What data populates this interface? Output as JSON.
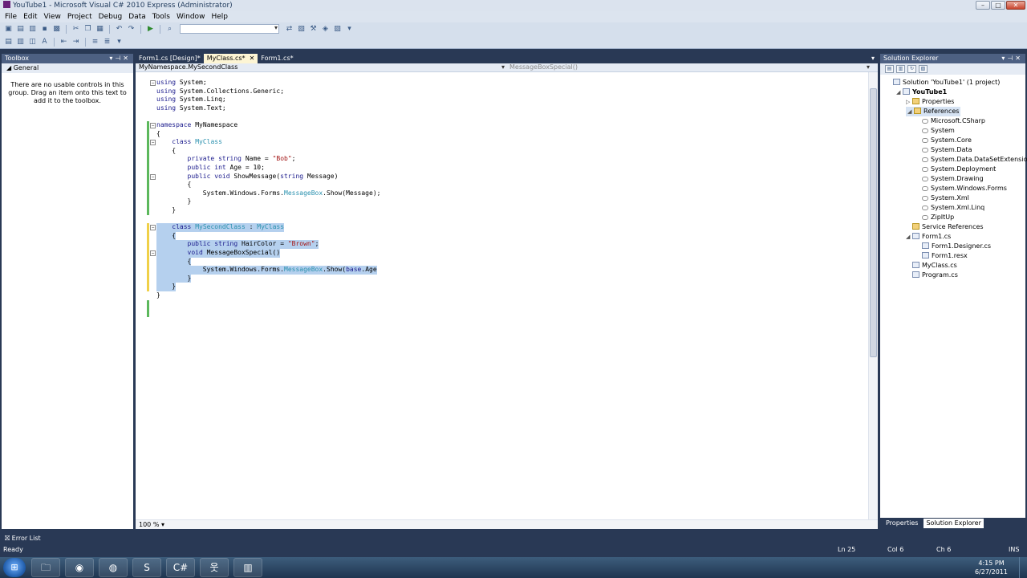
{
  "window": {
    "title": "YouTube1 - Microsoft Visual C# 2010 Express (Administrator)",
    "min": "–",
    "max": "□",
    "close": "✕"
  },
  "menu": [
    "File",
    "Edit",
    "View",
    "Project",
    "Debug",
    "Data",
    "Tools",
    "Window",
    "Help"
  ],
  "toolbox": {
    "title": "Toolbox",
    "group": "General",
    "message": "There are no usable controls in this group. Drag an item onto this text to add it to the toolbox."
  },
  "editor": {
    "tabs": [
      {
        "label": "Form1.cs [Design]*",
        "active": false
      },
      {
        "label": "MyClass.cs*",
        "active": true
      },
      {
        "label": "Form1.cs*",
        "active": false
      }
    ],
    "nav_left": "MyNamespace.MySecondClass",
    "nav_right": "MessageBoxSpecial()",
    "zoom": "100 %",
    "lines": [
      "using System;",
      "using System.Collections.Generic;",
      "using System.Linq;",
      "using System.Text;",
      "",
      "namespace MyNamespace",
      "{",
      "    class MyClass",
      "    {",
      "        private string Name = \"Bob\";",
      "        public int Age = 10;",
      "        public void ShowMessage(string Message)",
      "        {",
      "            System.Windows.Forms.MessageBox.Show(Message);",
      "        }",
      "    }",
      "",
      "    class MySecondClass : MyClass",
      "    {",
      "        public string HairColor = \"Brown\";",
      "        void MessageBoxSpecial()",
      "        {",
      "            System.Windows.Forms.MessageBox.Show(base.Age",
      "        }",
      "    }",
      "}"
    ]
  },
  "solution_explorer": {
    "title": "Solution Explorer",
    "items": [
      {
        "label": "Solution 'YouTube1' (1 project)",
        "level": 0,
        "icon": "solution",
        "exp": ""
      },
      {
        "label": "YouTube1",
        "level": 1,
        "icon": "project",
        "exp": "◢",
        "bold": true
      },
      {
        "label": "Properties",
        "level": 2,
        "icon": "folder",
        "exp": "▷"
      },
      {
        "label": "References",
        "level": 2,
        "icon": "folder",
        "exp": "◢",
        "selected": true
      },
      {
        "label": "Microsoft.CSharp",
        "level": 3,
        "icon": "ref"
      },
      {
        "label": "System",
        "level": 3,
        "icon": "ref"
      },
      {
        "label": "System.Core",
        "level": 3,
        "icon": "ref"
      },
      {
        "label": "System.Data",
        "level": 3,
        "icon": "ref"
      },
      {
        "label": "System.Data.DataSetExtensions",
        "level": 3,
        "icon": "ref"
      },
      {
        "label": "System.Deployment",
        "level": 3,
        "icon": "ref"
      },
      {
        "label": "System.Drawing",
        "level": 3,
        "icon": "ref"
      },
      {
        "label": "System.Windows.Forms",
        "level": 3,
        "icon": "ref"
      },
      {
        "label": "System.Xml",
        "level": 3,
        "icon": "ref"
      },
      {
        "label": "System.Xml.Linq",
        "level": 3,
        "icon": "ref"
      },
      {
        "label": "ZipItUp",
        "level": 3,
        "icon": "ref"
      },
      {
        "label": "Service References",
        "level": 2,
        "icon": "folder"
      },
      {
        "label": "Form1.cs",
        "level": 2,
        "icon": "form",
        "exp": "◢"
      },
      {
        "label": "Form1.Designer.cs",
        "level": 3,
        "icon": "file"
      },
      {
        "label": "Form1.resx",
        "level": 3,
        "icon": "file"
      },
      {
        "label": "MyClass.cs",
        "level": 2,
        "icon": "file"
      },
      {
        "label": "Program.cs",
        "level": 2,
        "icon": "file"
      }
    ],
    "bottom_tabs": [
      "Properties",
      "Solution Explorer"
    ]
  },
  "error_list": "Error List",
  "status": {
    "text": "Ready",
    "ln": "Ln 25",
    "col": "Col 6",
    "ch": "Ch 6",
    "ins": "INS"
  },
  "clock": {
    "time": "4:15 PM",
    "date": "6/27/2011"
  }
}
